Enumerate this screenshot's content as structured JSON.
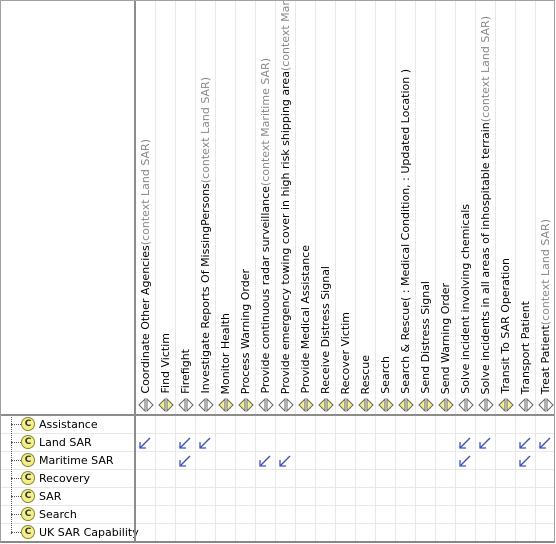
{
  "columns": [
    {
      "label": "Coordinate Other Agencies",
      "context": "(context Land SAR)",
      "icon": "gray"
    },
    {
      "label": "Find Victim",
      "context": "",
      "icon": "yellow"
    },
    {
      "label": "Firefight",
      "context": "",
      "icon": "gray"
    },
    {
      "label": "Investigate Reports Of MissingPersons",
      "context": "(context Land SAR)",
      "icon": "gray"
    },
    {
      "label": "Monitor Health",
      "context": "",
      "icon": "yellow"
    },
    {
      "label": "Process Warning Order",
      "context": "",
      "icon": "yellow"
    },
    {
      "label": "Provide continuous radar surveillance",
      "context": "(context Maritime SAR)",
      "icon": "gray"
    },
    {
      "label": "Provide emergency towing cover in high risk shipping area",
      "context": "(context Maritime SAR)",
      "icon": "gray"
    },
    {
      "label": "Provide Medical Assistance",
      "context": "",
      "icon": "yellow"
    },
    {
      "label": "Receive Distress Signal",
      "context": "",
      "icon": "yellow"
    },
    {
      "label": "Recover Victim",
      "context": "",
      "icon": "yellow"
    },
    {
      "label": "Rescue",
      "context": "",
      "icon": "yellow"
    },
    {
      "label": "Search",
      "context": "",
      "icon": "yellow"
    },
    {
      "label": "Search & Rescue(  : Medical Condition,   : Updated Location )",
      "context": "",
      "icon": "yellow"
    },
    {
      "label": "Send Distress Signal",
      "context": "",
      "icon": "yellow"
    },
    {
      "label": "Send Warning Order",
      "context": "",
      "icon": "yellow"
    },
    {
      "label": "Solve incident involving chemicals",
      "context": "",
      "icon": "gray"
    },
    {
      "label": "Solve incidents in all areas of inhospitable terrain",
      "context": "(context Land SAR)",
      "icon": "gray"
    },
    {
      "label": "Transit To SAR Operation",
      "context": "",
      "icon": "yellow"
    },
    {
      "label": "Transport Patient",
      "context": "",
      "icon": "gray"
    },
    {
      "label": "Treat Patient",
      "context": "(context Land SAR)",
      "icon": "gray"
    }
  ],
  "rows": [
    {
      "label": "Assistance",
      "badge": "C",
      "marks": []
    },
    {
      "label": "Land SAR",
      "badge": "C",
      "marks": [
        0,
        2,
        3,
        16,
        17,
        19,
        20
      ]
    },
    {
      "label": "Maritime SAR",
      "badge": "C",
      "marks": [
        2,
        6,
        7,
        16,
        19
      ]
    },
    {
      "label": "Recovery",
      "badge": "C",
      "marks": []
    },
    {
      "label": "SAR",
      "badge": "C",
      "marks": []
    },
    {
      "label": "Search",
      "badge": "C",
      "marks": []
    },
    {
      "label": "UK SAR Capability",
      "badge": "C",
      "marks": []
    }
  ],
  "colors": {
    "arrow": "#3c4fc0",
    "operation_icon": "#f3ef8c",
    "context_icon": "#ffffff"
  }
}
